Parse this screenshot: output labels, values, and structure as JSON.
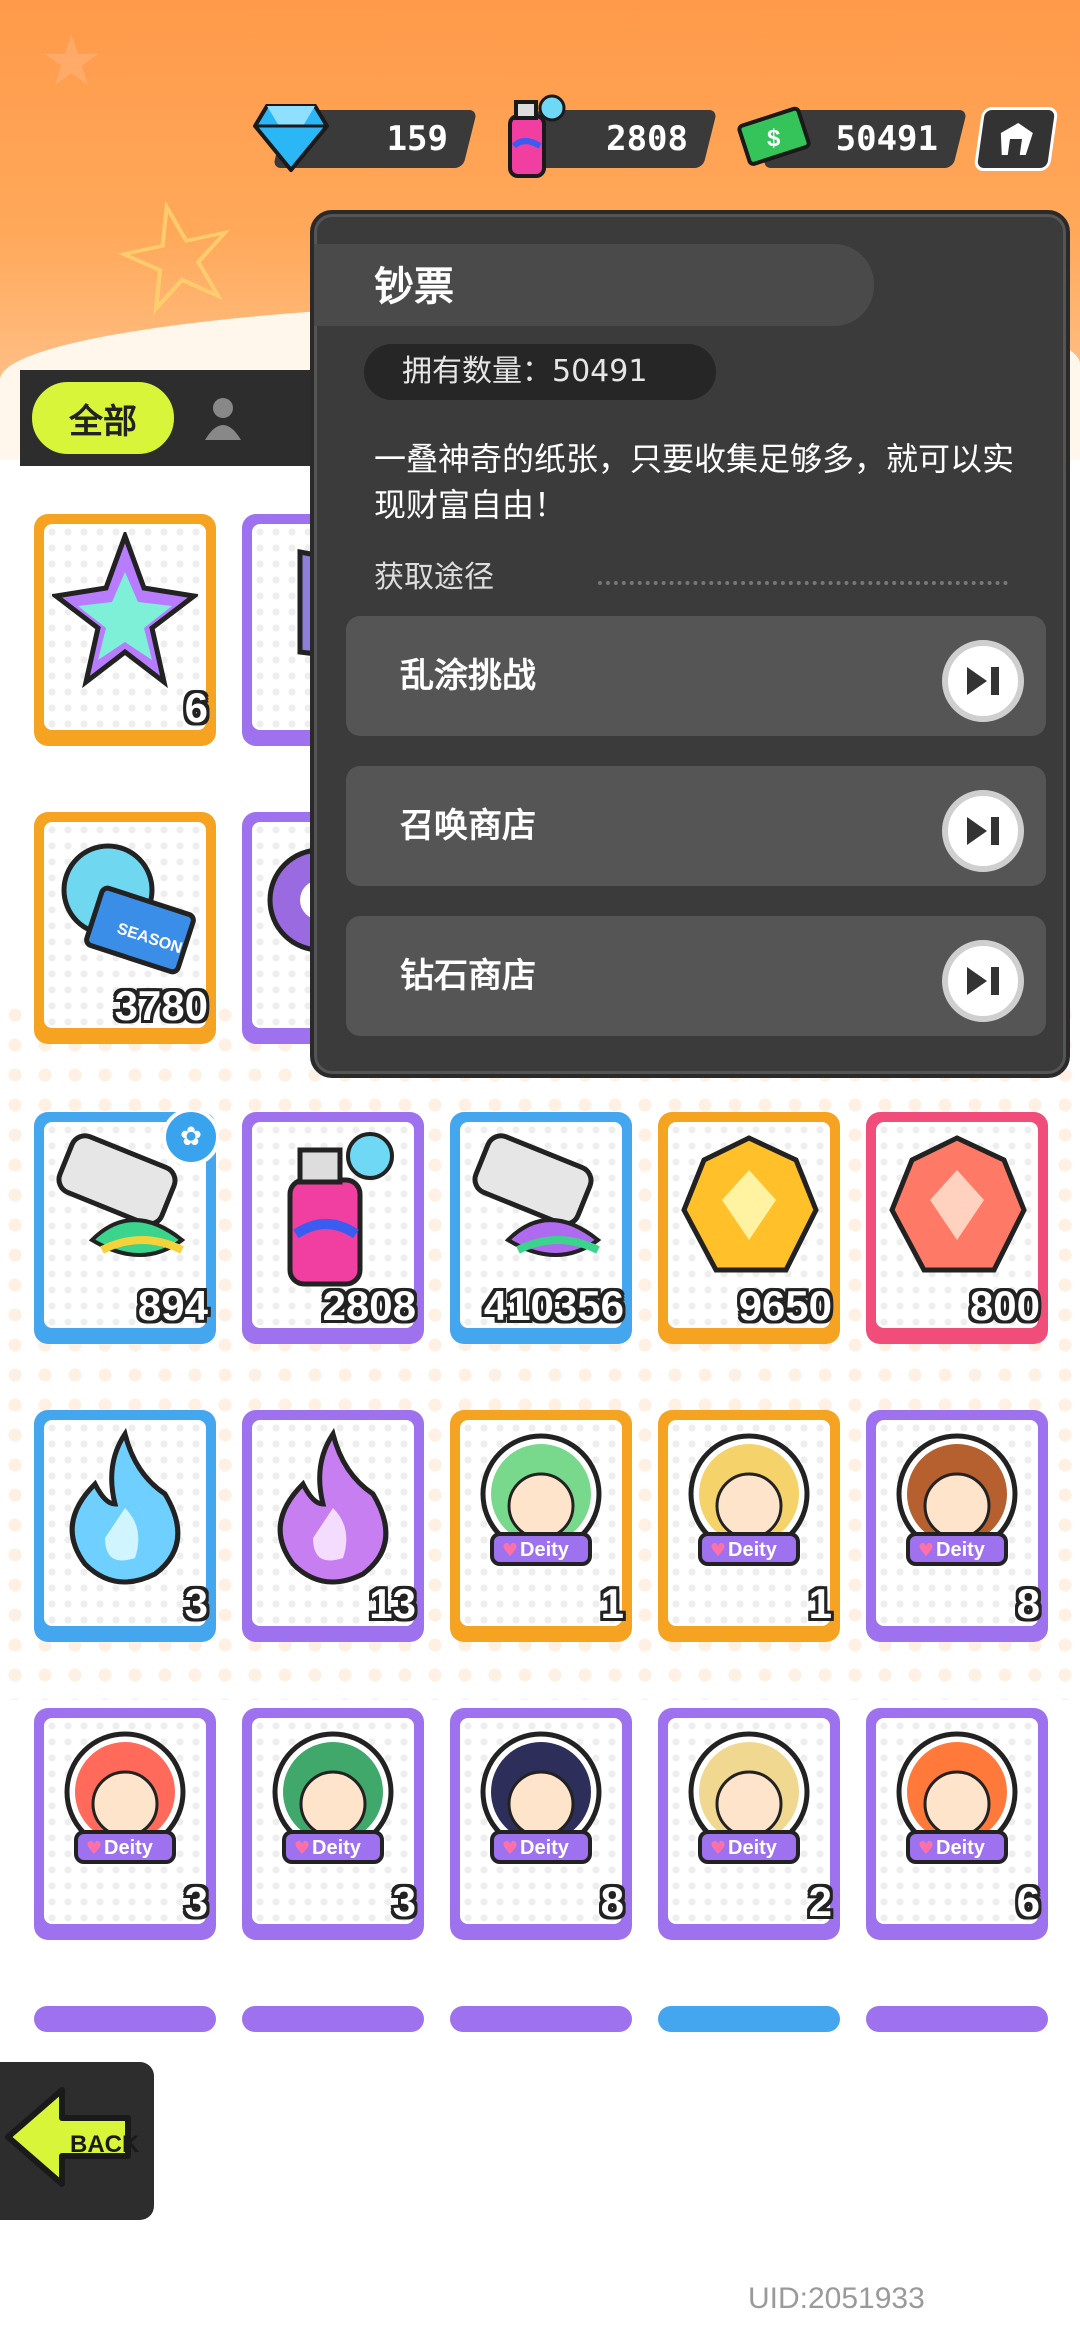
{
  "currencies": [
    {
      "name": "diamond",
      "icon": "diamond-icon",
      "value": "159"
    },
    {
      "name": "spray",
      "icon": "spray-can-icon",
      "value": "2808"
    },
    {
      "name": "banknote",
      "icon": "banknote-icon",
      "value": "50491"
    }
  ],
  "tabs": {
    "all_label": "全部"
  },
  "popup": {
    "title": "钞票",
    "owned_label": "拥有数量：",
    "owned_value": "50491",
    "description": "一叠神奇的纸张，只要收集足够多，就可以实现财富自由！",
    "source_label": "获取途径",
    "routes": [
      {
        "label": "乱涂挑战"
      },
      {
        "label": "召唤商店"
      },
      {
        "label": "钻石商店"
      }
    ]
  },
  "items": [
    {
      "name": "crystal-star",
      "border": "orange",
      "count": "6"
    },
    {
      "name": "purple-star",
      "border": "purple",
      "count": ""
    },
    {
      "name": "season-ticket",
      "border": "orange",
      "count": "3780"
    },
    {
      "name": "purple-gear",
      "border": "purple",
      "count": ""
    },
    {
      "name": "paint-tube-blue",
      "border": "blue",
      "count": "894"
    },
    {
      "name": "spray-can",
      "border": "purple",
      "count": "2808"
    },
    {
      "name": "paint-tube",
      "border": "blue",
      "count": "410356"
    },
    {
      "name": "gold-gem",
      "border": "orange",
      "count": "9650"
    },
    {
      "name": "red-gem",
      "border": "pink",
      "count": "800"
    },
    {
      "name": "blue-flame",
      "border": "blue",
      "count": "3"
    },
    {
      "name": "purple-flame",
      "border": "purple",
      "count": "13"
    },
    {
      "name": "deity-green",
      "border": "orange",
      "count": "1"
    },
    {
      "name": "deity-blonde",
      "border": "orange",
      "count": "1"
    },
    {
      "name": "deity-brown",
      "border": "purple",
      "count": "8"
    },
    {
      "name": "deity-red",
      "border": "purple",
      "count": "3"
    },
    {
      "name": "deity-cap",
      "border": "purple",
      "count": "3"
    },
    {
      "name": "deity-dark",
      "border": "purple",
      "count": "8"
    },
    {
      "name": "deity-gold",
      "border": "purple",
      "count": "2"
    },
    {
      "name": "deity-orange",
      "border": "purple",
      "count": "6"
    }
  ],
  "deity_label": "Deity",
  "season_label": "SEASON",
  "back_label": "BACK",
  "uid": "UID:2051933",
  "colors": {
    "orange": "#f5a321",
    "purple": "#9e72ee",
    "blue": "#44a6ee",
    "pink": "#f04d7b",
    "accent": "#d9f53a"
  }
}
